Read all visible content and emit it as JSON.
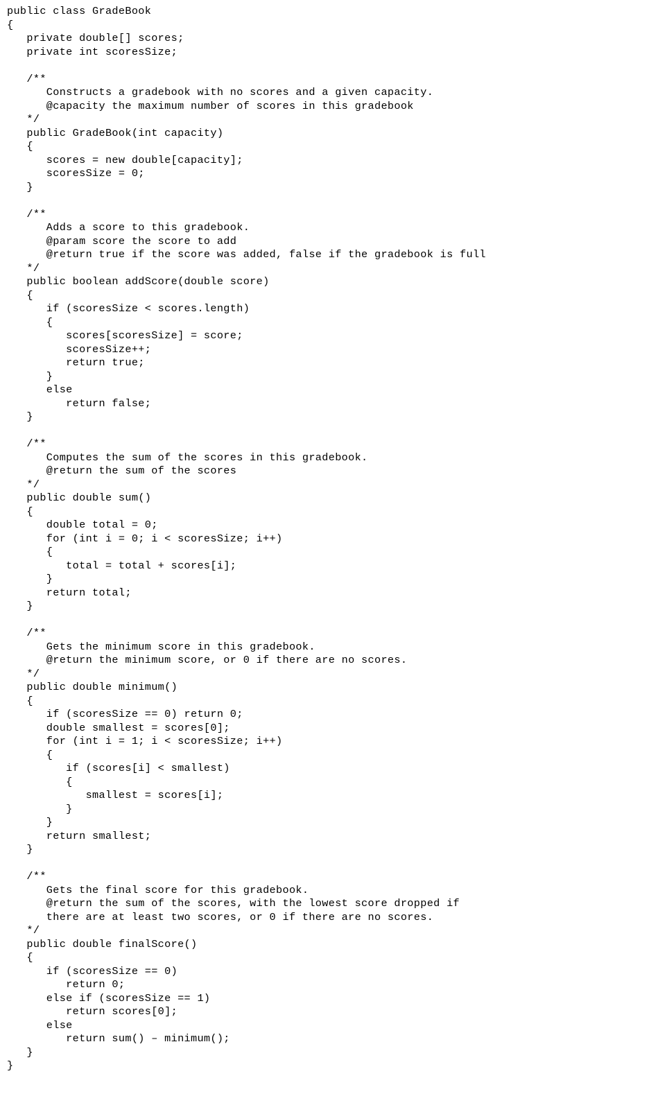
{
  "document": {
    "kind": "source-code-listing",
    "language": "Java",
    "class_name": "GradeBook",
    "background_color": "#ffffff",
    "text_color": "#000000",
    "indent_unit_spaces": 3,
    "total_lines": 80
  },
  "code": {
    "lines": [
      "public class GradeBook",
      "{",
      "   private double[] scores;",
      "   private int scoresSize;",
      "",
      "   /**",
      "      Constructs a gradebook with no scores and a given capacity.",
      "      @capacity the maximum number of scores in this gradebook",
      "   */",
      "   public GradeBook(int capacity)",
      "   {",
      "      scores = new double[capacity];",
      "      scoresSize = 0;",
      "   }",
      "",
      "   /**",
      "      Adds a score to this gradebook.",
      "      @param score the score to add",
      "      @return true if the score was added, false if the gradebook is full",
      "   */",
      "   public boolean addScore(double score)",
      "   {",
      "      if (scoresSize < scores.length)",
      "      {",
      "         scores[scoresSize] = score;",
      "         scoresSize++;",
      "         return true;",
      "      }",
      "      else",
      "         return false;",
      "   }",
      "",
      "   /**",
      "      Computes the sum of the scores in this gradebook.",
      "      @return the sum of the scores",
      "   */",
      "   public double sum()",
      "   {",
      "      double total = 0;",
      "      for (int i = 0; i < scoresSize; i++)",
      "      {",
      "         total = total + scores[i];",
      "      }",
      "      return total;",
      "   }",
      "",
      "   /**",
      "      Gets the minimum score in this gradebook.",
      "      @return the minimum score, or 0 if there are no scores.",
      "   */",
      "   public double minimum()",
      "   {",
      "      if (scoresSize == 0) return 0;",
      "      double smallest = scores[0];",
      "      for (int i = 1; i < scoresSize; i++)",
      "      {",
      "         if (scores[i] < smallest)",
      "         {",
      "            smallest = scores[i];",
      "         }",
      "      }",
      "      return smallest;",
      "   }",
      "",
      "   /**",
      "      Gets the final score for this gradebook.",
      "      @return the sum of the scores, with the lowest score dropped if",
      "      there are at least two scores, or 0 if there are no scores.",
      "   */",
      "   public double finalScore()",
      "   {",
      "      if (scoresSize == 0)",
      "         return 0;",
      "      else if (scoresSize == 1)",
      "         return scores[0];",
      "      else",
      "         return sum() – minimum();",
      "   }",
      "}"
    ]
  }
}
